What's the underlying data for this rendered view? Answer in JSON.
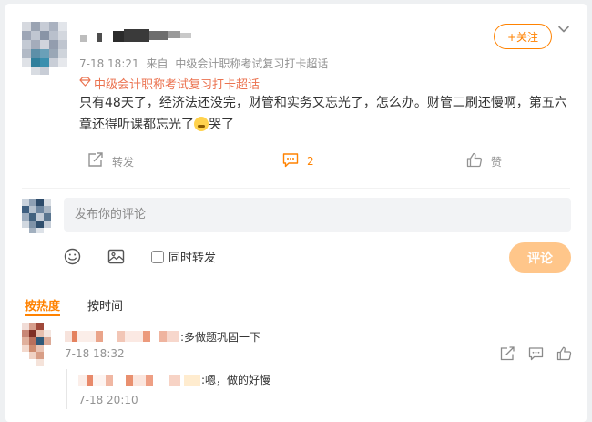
{
  "post": {
    "meta_time": "7-18 18:21",
    "meta_source_prefix": "来自",
    "meta_source": "中级会计职称考试复习打卡超话",
    "follow_label": "+关注",
    "topic_label": "中级会计职称考试复习打卡超话",
    "text_before_emoji": "只有48天了，经济法还没完，财管和实务又忘光了，怎么办。财管二刷还慢啊，第五六章还得听课都忘光了",
    "text_after_emoji": "哭了"
  },
  "actions": {
    "repost_label": "转发",
    "comment_count": "2",
    "like_label": "赞"
  },
  "composer": {
    "placeholder": "发布你的评论",
    "also_repost_label": "同时转发",
    "submit_label": "评论"
  },
  "sort_tabs": {
    "hot": "按热度",
    "time": "按时间"
  },
  "comments": [
    {
      "text": ":多做题巩固一下",
      "time": "7-18 18:32"
    }
  ],
  "replies": [
    {
      "text": ":嗯，做的好慢",
      "time": "7-18 20:10"
    }
  ],
  "icons": {
    "topic": "diamond-icon",
    "dropdown": "chevron-down-icon",
    "repost": "share-icon",
    "comment": "comment-icon",
    "like": "thumbs-up-icon",
    "emoji_tool": "smiley-icon",
    "image_tool": "image-icon"
  },
  "colors": {
    "accent": "#ff8200",
    "topic": "#eb7350",
    "submit_disabled": "#ffc68a",
    "muted": "#939393"
  }
}
